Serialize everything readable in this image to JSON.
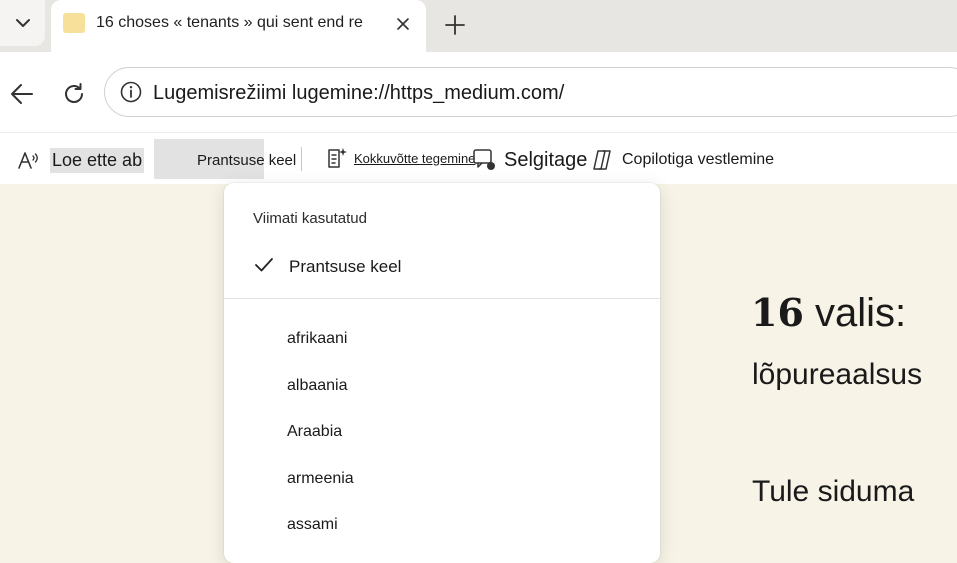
{
  "tab": {
    "title": "16 choses « tenants » qui sent end re"
  },
  "address_bar": {
    "url": "Lugemisrežiimi lugemine://https_medium.com/"
  },
  "reader_toolbar": {
    "read_aloud": "Loe ette ab",
    "translate": "Prantsuse keel",
    "summarize": "Kokkuvõtte tegemine",
    "explain": "Selgitage",
    "copilot": "Copilotiga vestlemine"
  },
  "language_dropdown": {
    "header": "Viimati kasutatud",
    "selected": "Prantsuse keel",
    "languages": [
      "afrikaani",
      "albaania",
      "Araabia",
      "armeenia",
      "assami"
    ]
  },
  "article": {
    "title_number": "16",
    "title_text": "valis:",
    "subtitle": "lõpureaalsus",
    "subtitle2": "Tule siduma"
  }
}
